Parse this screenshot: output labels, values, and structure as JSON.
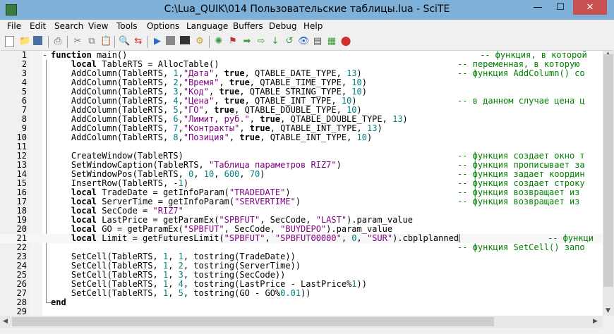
{
  "window": {
    "title": "C:\\Lua_QUIK\\014 Пользовательские таблицы.lua - SciTE",
    "minimize_glyph": "—",
    "maximize_glyph": "☐",
    "close_glyph": "✕"
  },
  "menu": [
    "File",
    "Edit",
    "Search",
    "View",
    "Tools",
    "Options",
    "Language",
    "Buffers",
    "Debug",
    "Help"
  ],
  "toolbar": {
    "icons": [
      "new-file-icon",
      "open-file-icon",
      "save-icon",
      "print-icon",
      "cut-icon",
      "copy-icon",
      "paste-icon",
      "find-icon",
      "replace-icon",
      "compile-icon",
      "stop-icon",
      "output-icon",
      "run-icon",
      "debug-icon",
      "tool-icon",
      "tool-icon",
      "tool-icon",
      "tool-icon",
      "tool-icon",
      "tool-icon",
      "tool-icon",
      "stop-debug-icon"
    ]
  },
  "colors": {
    "comment": "#007f00",
    "string": "#7f007f",
    "number": "#007f7f",
    "titlebar": "#7fb0d8",
    "close": "#c75050"
  },
  "editor": {
    "lines": [
      {
        "n": "1",
        "code": "function main()",
        "comment": "-- функция, в которой"
      },
      {
        "n": "2",
        "code": "    local TableRTS = AllocTable()",
        "comment": "-- переменная, в которую"
      },
      {
        "n": "3",
        "code": "    AddColumn(TableRTS, 1,\"Дата\", true, QTABLE_DATE_TYPE, 13)",
        "comment": "-- функция AddColumn() со"
      },
      {
        "n": "4",
        "code": "    AddColumn(TableRTS, 2,\"Время\", true, QTABLE_TIME_TYPE, 10)",
        "comment": ""
      },
      {
        "n": "5",
        "code": "    AddColumn(TableRTS, 3,\"Код\", true, QTABLE_STRING_TYPE, 10)",
        "comment": ""
      },
      {
        "n": "6",
        "code": "    AddColumn(TableRTS, 4,\"Цена\", true, QTABLE_INT_TYPE, 10)",
        "comment": "-- в данном случае цена ц"
      },
      {
        "n": "7",
        "code": "    AddColumn(TableRTS, 5,\"ГО\", true, QTABLE_DOUBLE_TYPE, 10)",
        "comment": ""
      },
      {
        "n": "8",
        "code": "    AddColumn(TableRTS, 6,\"Лимит, руб.\", true, QTABLE_DOUBLE_TYPE, 13)",
        "comment": ""
      },
      {
        "n": "9",
        "code": "    AddColumn(TableRTS, 7,\"Контракты\", true, QTABLE_INT_TYPE, 13)",
        "comment": ""
      },
      {
        "n": "10",
        "code": "    AddColumn(TableRTS, 8,\"Позиция\", true, QTABLE_INT_TYPE, 10)",
        "comment": ""
      },
      {
        "n": "11",
        "code": "",
        "comment": ""
      },
      {
        "n": "12",
        "code": "    CreateWindow(TableRTS)",
        "comment": "-- функция создает окно т"
      },
      {
        "n": "13",
        "code": "    SetWindowCaption(TableRTS, \"Таблица параметров RIZ7\")",
        "comment": "-- функция прописывает за"
      },
      {
        "n": "14",
        "code": "    SetWindowPos(TableRTS, 0, 10, 600, 70)",
        "comment": "-- функция задает координ"
      },
      {
        "n": "15",
        "code": "    InsertRow(TableRTS, -1)",
        "comment": "-- функция создает строку"
      },
      {
        "n": "16",
        "code": "    local TradeDate = getInfoParam(\"TRADEDATE\")",
        "comment": "-- функция возвращает из"
      },
      {
        "n": "17",
        "code": "    local ServerTime = getInfoParam(\"SERVERTIME\")",
        "comment": "-- функция возвращает из"
      },
      {
        "n": "18",
        "code": "    local SecCode = \"RIZ7\"",
        "comment": ""
      },
      {
        "n": "19",
        "code": "    local LastPrice = getParamEx(\"SPBFUT\", SecCode, \"LAST\").param_value",
        "comment": ""
      },
      {
        "n": "20",
        "code": "    local GO = getParamEx(\"SPBFUT\", SecCode, \"BUYDEPO\").param_value",
        "comment": ""
      },
      {
        "n": "21",
        "code": "    local Limit = getFuturesLimit(\"SPBFUT\", \"SPBFUT00000\", 0, \"SUR\").cbplplanned",
        "comment": "-- функци"
      },
      {
        "n": "22",
        "code": "",
        "comment": "-- функция SetCell() запо"
      },
      {
        "n": "23",
        "code": "    SetCell(TableRTS, 1, 1, tostring(TradeDate))",
        "comment": ""
      },
      {
        "n": "24",
        "code": "    SetCell(TableRTS, 1, 2, tostring(ServerTime))",
        "comment": ""
      },
      {
        "n": "25",
        "code": "    SetCell(TableRTS, 1, 3, tostring(SecCode))",
        "comment": ""
      },
      {
        "n": "26",
        "code": "    SetCell(TableRTS, 1, 4, tostring(LastPrice - LastPrice%1))",
        "comment": ""
      },
      {
        "n": "27",
        "code": "    SetCell(TableRTS, 1, 5, tostring(GO - GO%0.01))",
        "comment": ""
      },
      {
        "n": "28",
        "code": "end",
        "comment": ""
      },
      {
        "n": "29",
        "code": "",
        "comment": ""
      }
    ]
  }
}
